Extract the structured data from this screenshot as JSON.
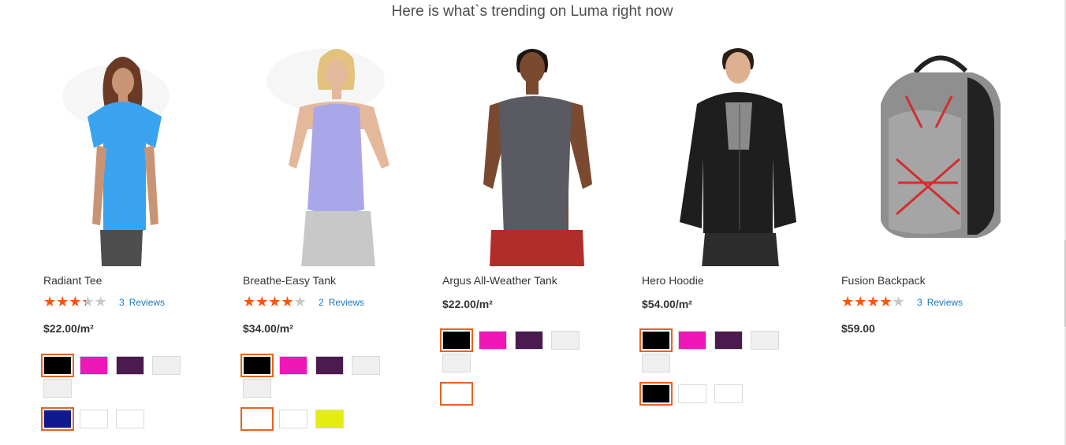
{
  "heading": "Here is what`s trending on Luma right now",
  "colors": {
    "star": "#ff5501",
    "star_empty": "#c7c7c7",
    "link": "#1979c3",
    "selected_border": "#e8621e"
  },
  "products": [
    {
      "name": "Radiant Tee",
      "rating": 3,
      "reviews_count": "3",
      "reviews_label": "Reviews",
      "price": "$22.00/m²",
      "swatches": [
        {
          "color": "#000000",
          "selected": true
        },
        {
          "color": "#ef17b8",
          "selected": false
        },
        {
          "color": "#4b1a4f",
          "selected": false
        },
        {
          "color": "#efefef",
          "selected": false
        },
        {
          "color": "#efefef",
          "selected": false
        },
        {
          "color": "#0e1a8e",
          "selected": true
        },
        {
          "color": "#ffffff",
          "selected": false
        },
        {
          "color": "#ffffff",
          "selected": false
        }
      ]
    },
    {
      "name": "Breathe-Easy Tank",
      "rating": 3.5,
      "reviews_count": "2",
      "reviews_label": "Reviews",
      "price": "$34.00/m²",
      "swatches": [
        {
          "color": "#000000",
          "selected": true
        },
        {
          "color": "#ef17b8",
          "selected": false
        },
        {
          "color": "#4b1a4f",
          "selected": false
        },
        {
          "color": "#efefef",
          "selected": false
        },
        {
          "color": "#efefef",
          "selected": false
        },
        {
          "color": "#ffffff",
          "selected": true
        },
        {
          "color": "#ffffff",
          "selected": false
        },
        {
          "color": "#e4ec12",
          "selected": false
        }
      ]
    },
    {
      "name": "Argus All-Weather Tank",
      "price": "$22.00/m²",
      "swatches": [
        {
          "color": "#000000",
          "selected": true
        },
        {
          "color": "#ef17b8",
          "selected": false
        },
        {
          "color": "#4b1a4f",
          "selected": false
        },
        {
          "color": "#efefef",
          "selected": false
        },
        {
          "color": "#efefef",
          "selected": false
        },
        {
          "color": "#ffffff",
          "selected": true
        }
      ]
    },
    {
      "name": "Hero Hoodie",
      "price": "$54.00/m²",
      "swatches": [
        {
          "color": "#000000",
          "selected": true
        },
        {
          "color": "#ef17b8",
          "selected": false
        },
        {
          "color": "#4b1a4f",
          "selected": false
        },
        {
          "color": "#efefef",
          "selected": false
        },
        {
          "color": "#efefef",
          "selected": false
        },
        {
          "color": "#000000",
          "selected": true
        },
        {
          "color": "#ffffff",
          "selected": false
        },
        {
          "color": "#ffffff",
          "selected": false
        }
      ]
    },
    {
      "name": "Fusion Backpack",
      "rating": 3.5,
      "reviews_count": "3",
      "reviews_label": "Reviews",
      "price": "$59.00",
      "swatches": []
    }
  ]
}
